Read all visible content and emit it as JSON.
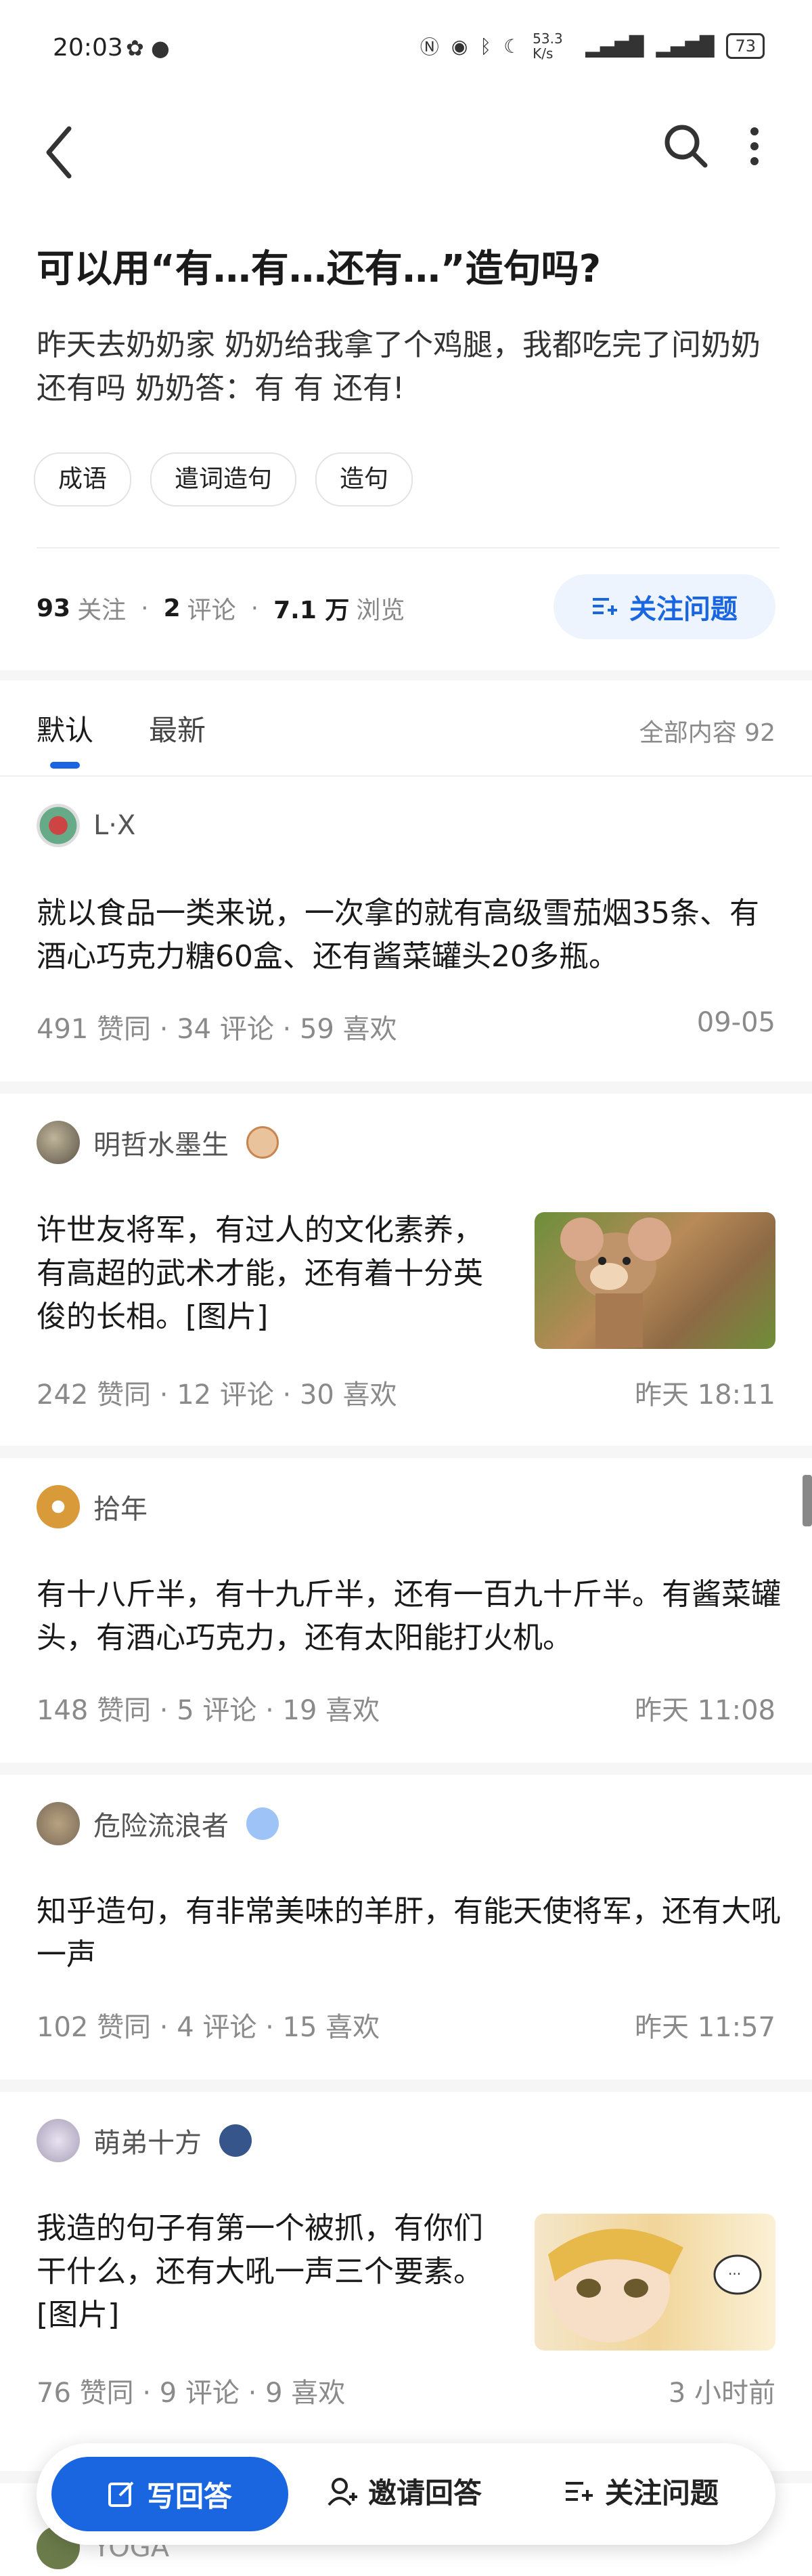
{
  "status_bar": {
    "time": "20:03",
    "battery": "73",
    "speed": "53.3 K/s"
  },
  "nav": {
    "back_icon": "back-arrow-icon",
    "search_icon": "search-icon",
    "more_icon": "more-vertical-icon"
  },
  "question": {
    "title": "可以用“有…有…还有…”造句吗?",
    "description": "昨天去奶奶家 奶奶给我拿了个鸡腿，我都吃完了问奶奶还有吗 奶奶答：有 有 还有!",
    "tags": [
      "成语",
      "遣词造句",
      "造句"
    ],
    "followers": "93",
    "followers_label": "关注",
    "comments": "2",
    "comments_label": "评论",
    "views": "7.1 万",
    "views_label": "浏览",
    "follow_label": "关注问题"
  },
  "tabs": {
    "default": "默认",
    "newest": "最新",
    "all_count": "全部内容 92"
  },
  "answers": [
    {
      "author": "L·X",
      "content": "就以食品一类来说，一次拿的就有高级雪茄烟35条、有酒心巧克力糖60盒、还有酱菜罐头20多瓶。",
      "stats": "491 赞同 · 34 评论 · 59 喜欢",
      "date": "09-05"
    },
    {
      "author": "明哲水墨生",
      "content": "许世友将军，有过人的文化素养，有高超的武术才能，还有着十分英俊的长相。[图片]",
      "stats": "242 赞同 · 12 评论 · 30 喜欢",
      "date": "昨天 18:11"
    },
    {
      "author": "拾年",
      "content": "有十八斤半，有十九斤半，还有一百九十斤半。有酱菜罐头，有酒心巧克力，还有太阳能打火机。",
      "stats": "148 赞同 · 5 评论 · 19 喜欢",
      "date": "昨天 11:08"
    },
    {
      "author": "危险流浪者",
      "content": "知乎造句，有非常美味的羊肝，有能天使将军，还有大吼一声",
      "stats": "102 赞同 · 4 评论 · 15 喜欢",
      "date": "昨天 11:57"
    },
    {
      "author": "萌弟十方",
      "content": "我造的句子有第一个被抓，有你们干什么，还有大吼一声三个要素。[图片]",
      "stats": "76 赞同 · 9 评论 · 9 喜欢",
      "date": "3 小时前"
    }
  ],
  "next_author": "YOGA",
  "action_bar": {
    "write": "写回答",
    "invite": "邀请回答",
    "follow": "关注问题"
  },
  "colors": {
    "accent": "#1966e0",
    "accent_bg": "#eef4fe"
  }
}
